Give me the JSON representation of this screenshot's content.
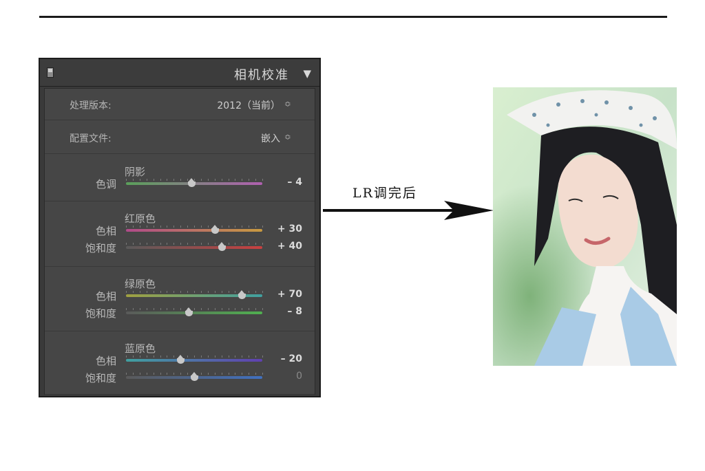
{
  "panel": {
    "title": "相机校准",
    "collapse_glyph": "▼",
    "process": {
      "label": "处理版本:",
      "value": "2012（当前）",
      "arrows": "≎"
    },
    "profile": {
      "label": "配置文件:",
      "value": "嵌入",
      "arrows": "≎"
    },
    "groups": [
      {
        "title": "阴影",
        "sliders": [
          {
            "label": "色调",
            "value": "– 4",
            "level": -4,
            "track": [
              "#5aa05a",
              "#b060b0"
            ]
          }
        ]
      },
      {
        "title": "红原色",
        "sliders": [
          {
            "label": "色相",
            "value": "+ 30",
            "level": 30,
            "track": [
              "#b04a8a",
              "#c89a40"
            ]
          },
          {
            "label": "饱和度",
            "value": "+ 40",
            "level": 40,
            "track": [
              "#5a5a5a",
              "#c84040"
            ]
          }
        ]
      },
      {
        "title": "绿原色",
        "sliders": [
          {
            "label": "色相",
            "value": "+ 70",
            "level": 70,
            "track": [
              "#a0a040",
              "#40a0a0"
            ]
          },
          {
            "label": "饱和度",
            "value": "– 8",
            "level": -8,
            "track": [
              "#5a5a5a",
              "#50b050"
            ]
          }
        ]
      },
      {
        "title": "蓝原色",
        "sliders": [
          {
            "label": "色相",
            "value": "– 20",
            "level": -20,
            "track": [
              "#40a0a0",
              "#6040b0"
            ]
          },
          {
            "label": "饱和度",
            "value": "0",
            "level": 0,
            "track": [
              "#5a5a5a",
              "#4070c0"
            ],
            "dim": true
          }
        ]
      }
    ]
  },
  "annotation": {
    "caption": "LR调完后"
  },
  "colors": {
    "panel_bg": "#3a3a3a",
    "panel_body": "#464646",
    "text": "#b8b8b8"
  }
}
